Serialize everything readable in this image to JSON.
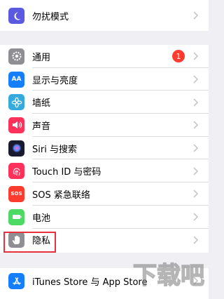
{
  "rows": [
    {
      "label": "勿扰模式",
      "icon": "moon-icon",
      "color": "#5a5ae0"
    },
    {
      "label": "通用",
      "icon": "gear-icon",
      "color": "#8e8e93",
      "badge": "1"
    },
    {
      "label": "显示与亮度",
      "icon": "aa-icon",
      "color": "#147efb"
    },
    {
      "label": "墙纸",
      "icon": "flower-icon",
      "color": "#35aadc"
    },
    {
      "label": "声音",
      "icon": "speaker-icon",
      "color": "#fd315a"
    },
    {
      "label": "Siri 与搜索",
      "icon": "siri-icon",
      "color": "#1a1a2e"
    },
    {
      "label": "Touch ID 与密码",
      "icon": "fingerprint-icon",
      "color": "#fd315a"
    },
    {
      "label": "SOS 紧急联络",
      "icon": "sos-icon",
      "color": "#fd3c2f"
    },
    {
      "label": "电池",
      "icon": "battery-icon",
      "color": "#4cd964"
    },
    {
      "label": "隐私",
      "icon": "hand-icon",
      "color": "#8e8e93"
    },
    {
      "label": "iTunes Store 与 App Store",
      "icon": "app-store-icon",
      "color": "#147efb"
    }
  ],
  "icon_text": {
    "display": "AA",
    "sos": "SOS"
  },
  "watermark": "下载吧"
}
